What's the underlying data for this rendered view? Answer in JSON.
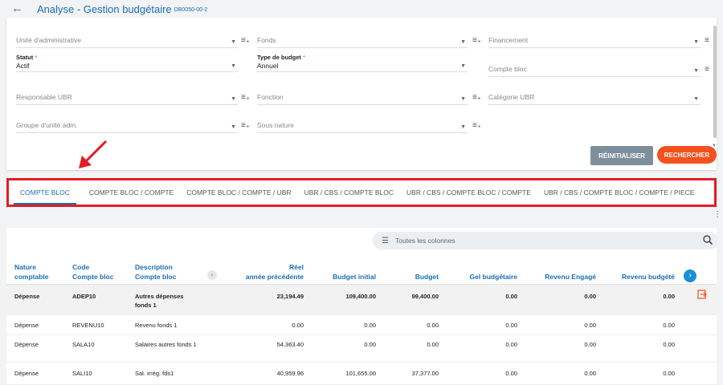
{
  "header": {
    "back_icon": "arrow-left-icon",
    "title": "Analyse - Gestion budgétaire",
    "code": "DB0050-00-2"
  },
  "filters": {
    "unite_adm": "Unité d'administrative",
    "fonds": "Fonds",
    "financement": "Financement",
    "statut_label": "Statut",
    "statut_value": "Actif",
    "type_budget_label": "Type de budget",
    "type_budget_value": "Annuel",
    "compte_bloc": "Compte bloc",
    "responsable_ubr": "Responsable UBR",
    "fonction": "Fonction",
    "categorie_ubr": "Catégorie UBR",
    "groupe_unite": "Groupe d'unité adm.",
    "sous_nature": "Sous nature",
    "required_mark": "*"
  },
  "buttons": {
    "reset": "RÉINITIALISER",
    "search": "RECHERCHER"
  },
  "tabs": [
    "COMPTE BLOC",
    "COMPTE BLOC / COMPTE",
    "COMPTE BLOC / COMPTE / UBR",
    "UBR / CBS / COMPTE BLOC",
    "UBR / CBS / COMPTE BLOC / COMPTE",
    "UBR / CBS / COMPTE BLOC / COMPTE / PIECE"
  ],
  "active_tab": "COMPTE BLOC",
  "column_search": {
    "placeholder": "Toutes les colonnes"
  },
  "table": {
    "headers": {
      "nature": [
        "Nature",
        "comptable"
      ],
      "code": [
        "Code",
        "Compte bloc"
      ],
      "description": [
        "Description",
        "Compte bloc"
      ],
      "reel": [
        "Réel",
        "année précédente"
      ],
      "budget_initial": "Budget initial",
      "budget": "Budget",
      "gel": "Gel budgétaire",
      "revenu_engage": "Revenu Engagé",
      "revenu_budgete": "Revenu budgété"
    },
    "rows": [
      {
        "nature": "Dépense",
        "code": "ADEP10",
        "description": "Autres dépenses fonds 1",
        "reel": "23,194.49",
        "budget_initial": "109,400.00",
        "budget": "99,400.00",
        "gel": "0.00",
        "revenu_engage": "0.00",
        "revenu_budgete": "0.00"
      },
      {
        "nature": "Dépense",
        "code": "REVENU10",
        "description": "Revenu fonds 1",
        "reel": "0.00",
        "budget_initial": "0.00",
        "budget": "0.00",
        "gel": "0.00",
        "revenu_engage": "0.00",
        "revenu_budgete": "0.00"
      },
      {
        "nature": "Dépense",
        "code": "SALA10",
        "description": "Salaires autres fonds 1",
        "reel": "54,363.40",
        "budget_initial": "0.00",
        "budget": "0.00",
        "gel": "0.00",
        "revenu_engage": "0.00",
        "revenu_budgete": "0.00"
      },
      {
        "nature": "Dépense",
        "code": "SALI10",
        "description": "Sal. irrég. fds1",
        "reel": "40,959.96",
        "budget_initial": "101,655.00",
        "budget": "37,377.00",
        "gel": "0.00",
        "revenu_engage": "0.00",
        "revenu_budgete": "0.00"
      }
    ]
  },
  "colors": {
    "accent": "#1a6fb5",
    "danger": "#f4511e",
    "highlight": "#e21c23",
    "neutral_button": "#7e8f9c"
  }
}
